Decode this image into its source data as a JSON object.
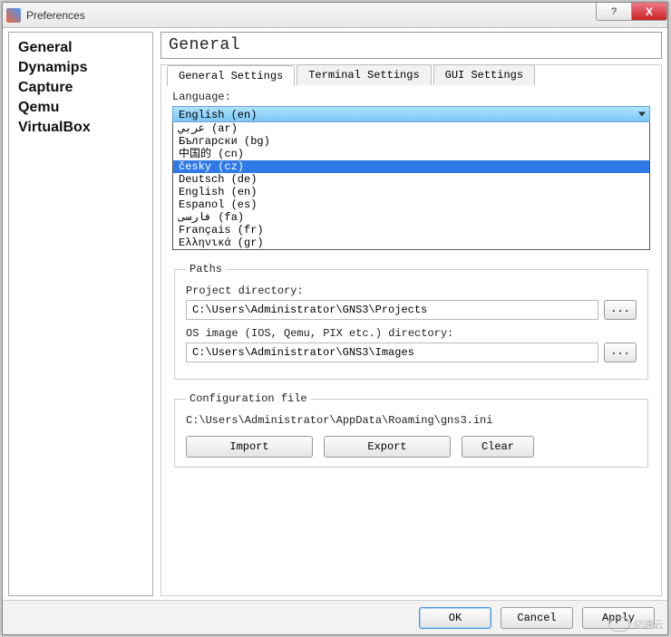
{
  "window": {
    "title": "Preferences",
    "controls": {
      "help": "?",
      "close": "X"
    }
  },
  "sidebar": {
    "items": [
      {
        "label": "General"
      },
      {
        "label": "Dynamips"
      },
      {
        "label": "Capture"
      },
      {
        "label": "Qemu"
      },
      {
        "label": "VirtualBox"
      }
    ],
    "selected_index": 0
  },
  "main": {
    "heading": "General",
    "tabs": [
      {
        "label": "General Settings"
      },
      {
        "label": "Terminal Settings"
      },
      {
        "label": "GUI Settings"
      }
    ],
    "active_tab": 0,
    "language": {
      "label": "Language:",
      "selected": "English (en)",
      "options": [
        "عربي (ar)",
        "Български (bg)",
        "中国的 (cn)",
        "česky (cz)",
        "Deutsch (de)",
        "English (en)",
        "Espanol (es)",
        "فارسی (fa)",
        "Français (fr)",
        "Ελληνικά (gr)"
      ],
      "highlighted_index": 3
    },
    "paths": {
      "legend": "Paths",
      "project_label": "Project directory:",
      "project_value": "C:\\Users\\Administrator\\GNS3\\Projects",
      "image_label": "OS image (IOS, Qemu, PIX etc.) directory:",
      "image_value": "C:\\Users\\Administrator\\GNS3\\Images",
      "browse_label": "..."
    },
    "config": {
      "legend": "Configuration file",
      "path": "C:\\Users\\Administrator\\AppData\\Roaming\\gns3.ini",
      "import": "Import",
      "export": "Export",
      "clear": "Clear"
    }
  },
  "footer": {
    "ok": "OK",
    "cancel": "Cancel",
    "apply": "Apply"
  },
  "watermark": "亿速云"
}
